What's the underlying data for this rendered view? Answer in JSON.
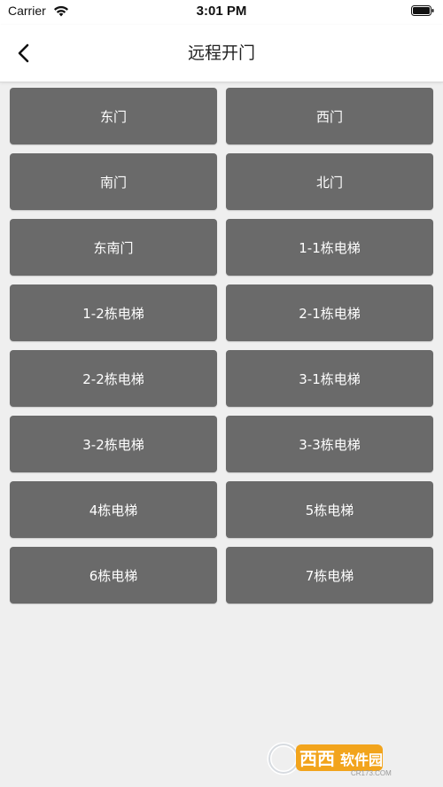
{
  "status_bar": {
    "carrier": "Carrier",
    "time": "3:01 PM",
    "wifi_icon": "wifi-icon",
    "battery_icon": "battery-icon"
  },
  "nav": {
    "title": "远程开门",
    "back_icon": "chevron-left-icon"
  },
  "doors": [
    "东门",
    "西门",
    "南门",
    "北门",
    "东南门",
    "1-1栋电梯",
    "1-2栋电梯",
    "2-1栋电梯",
    "2-2栋电梯",
    "3-1栋电梯",
    "3-2栋电梯",
    "3-3栋电梯",
    "4栋电梯",
    "5栋电梯",
    "6栋电梯",
    "7栋电梯"
  ],
  "watermark": {
    "text": "西西软件园",
    "subtext": "CR173.COM"
  },
  "colors": {
    "button_bg": "#6a6a6a",
    "page_bg": "#efefef",
    "nav_bg": "#ffffff"
  }
}
